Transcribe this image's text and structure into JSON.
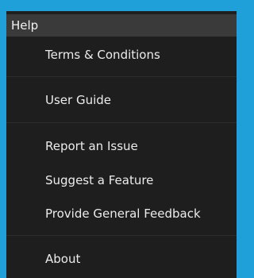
{
  "menu": {
    "title": "Help",
    "items": [
      {
        "label": "Terms & Conditions"
      },
      {
        "label": "User Guide"
      },
      {
        "label": "Report an Issue"
      },
      {
        "label": "Suggest a Feature"
      },
      {
        "label": "Provide General Feedback"
      },
      {
        "label": "About"
      }
    ]
  },
  "colors": {
    "accent_border": "#1fa0d8",
    "header_bg": "#3a3a3a",
    "menu_bg": "#1e1e1e",
    "text": "#ececec"
  }
}
